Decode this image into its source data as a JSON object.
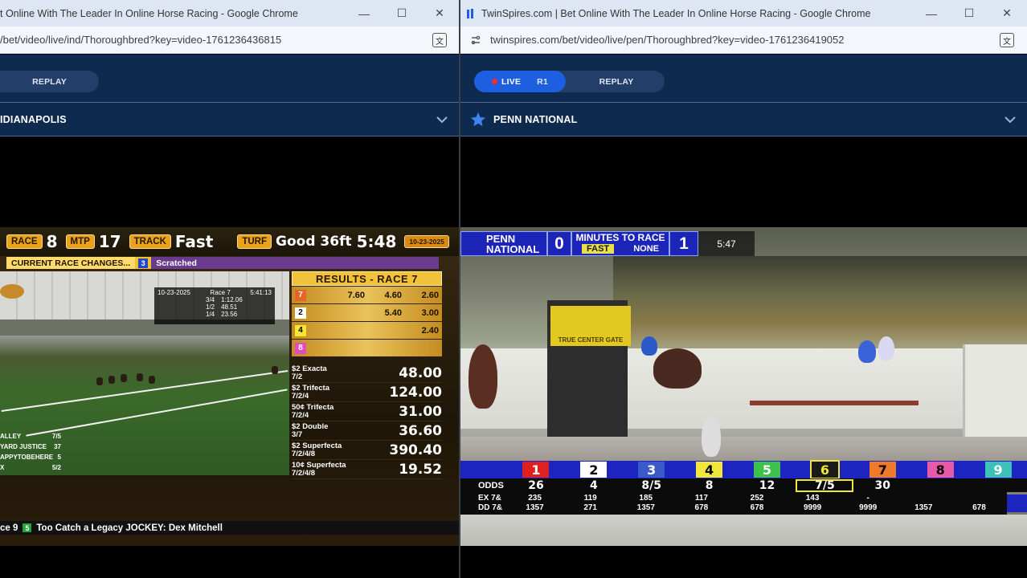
{
  "left": {
    "title": "t Online With The Leader In Online Horse Racing - Google Chrome",
    "url": "/bet/video/live/ind/Thoroughbred?key=video-1761236436815",
    "replay_label": "REPLAY",
    "track": "IDIANAPOLIS",
    "hud": {
      "race_label": "RACE",
      "race": "8",
      "mtp_label": "MTP",
      "mtp": "17",
      "track_label": "TRACK",
      "track_cond": "Fast",
      "turf_label": "TURF",
      "turf_cond": "Good 36ft",
      "clock": "5:48",
      "date": "10-23-2025"
    },
    "changes": {
      "label": "CURRENT RACE CHANGES...",
      "num": "3",
      "text": "Scratched"
    },
    "mini": {
      "date": "10-23-2025",
      "race": "Race 7",
      "time": "5:41:13",
      "f1": "3/4",
      "v1": "1:12.06",
      "f2": "1/2",
      "v2": "48.51",
      "f3": "1/4",
      "v3": "23.56"
    },
    "results": {
      "title": "RESULTS - RACE 7",
      "rows": [
        {
          "pp": "7",
          "pp_bg": "#e8632a",
          "pp_fg": "#ffffff",
          "win": "7.60",
          "place": "4.60",
          "show": "2.60"
        },
        {
          "pp": "2",
          "pp_bg": "#ffffff",
          "pp_fg": "#000000",
          "win": "",
          "place": "5.40",
          "show": "3.00"
        },
        {
          "pp": "4",
          "pp_bg": "#f5e633",
          "pp_fg": "#000000",
          "win": "",
          "place": "",
          "show": "2.40"
        },
        {
          "pp": "8",
          "pp_bg": "#e04ac5",
          "pp_fg": "#ffffff",
          "win": "",
          "place": "",
          "show": ""
        }
      ]
    },
    "exotics": [
      {
        "name": "$2 Exacta",
        "combo": "7/2",
        "payout": "48.00"
      },
      {
        "name": "$2 Trifecta",
        "combo": "7/2/4",
        "payout": "124.00"
      },
      {
        "name": "50¢ Trifecta",
        "combo": "7/2/4",
        "payout": "31.00"
      },
      {
        "name": "$2 Double",
        "combo": "3/7",
        "payout": "36.60"
      },
      {
        "name": "$2 Superfecta",
        "combo": "7/2/4/8",
        "payout": "390.40"
      },
      {
        "name": "10¢ Superfecta",
        "combo": "7/2/4/8",
        "payout": "19.52"
      }
    ],
    "pool": [
      {
        "name": "ALLEY",
        "odds": "7/5"
      },
      {
        "name": "YARD JUSTICE",
        "odds": "37"
      },
      {
        "name": "APPYTOBEHERE",
        "odds": "5"
      },
      {
        "name": "X",
        "odds": "5/2"
      }
    ],
    "ticker": {
      "prefix": "ce 9",
      "num": "5",
      "text": "Too Catch a Legacy  JOCKEY: Dex Mitchell"
    }
  },
  "right": {
    "title": "TwinSpires.com | Bet Online With The Leader In Online Horse Racing - Google Chrome",
    "url": "twinspires.com/bet/video/live/pen/Thoroughbred?key=video-1761236419052",
    "live_label": "LIVE",
    "race_label": "R1",
    "replay_label": "REPLAY",
    "track": "PENN NATIONAL",
    "hud": {
      "name": "PENN NATIONAL",
      "mtp": "0",
      "mtr_label": "MINUTES TO RACE",
      "cond": "FAST",
      "cond2": "NONE",
      "race": "1",
      "time": "5:47"
    },
    "gate_text": "TRUE CENTER GATE",
    "pps": [
      {
        "n": "1",
        "bg": "#e02020",
        "fg": "#ffffff",
        "odds": "26",
        "ex": "235",
        "dd": "1357"
      },
      {
        "n": "2",
        "bg": "#ffffff",
        "fg": "#000000",
        "odds": "4",
        "ex": "119",
        "dd": "271"
      },
      {
        "n": "3",
        "bg": "#3b59c8",
        "fg": "#ffffff",
        "odds": "8/5",
        "ex": "185",
        "dd": "1357"
      },
      {
        "n": "4",
        "bg": "#f3e63a",
        "fg": "#000000",
        "odds": "8",
        "ex": "117",
        "dd": "678"
      },
      {
        "n": "5",
        "bg": "#3ec14a",
        "fg": "#ffffff",
        "odds": "12",
        "ex": "252",
        "dd": "678"
      },
      {
        "n": "6",
        "bg": "#1a1a1a",
        "fg": "#f3e63a",
        "odds": "7/5",
        "ex": "143",
        "dd": "9999"
      },
      {
        "n": "7",
        "bg": "#f07a2a",
        "fg": "#000000",
        "odds": "30",
        "ex": "-",
        "dd": "9999"
      },
      {
        "n": "8",
        "bg": "#e85aa8",
        "fg": "#000000",
        "odds": "",
        "ex": "",
        "dd": "1357"
      },
      {
        "n": "9",
        "bg": "#3cc0b8",
        "fg": "#ffffff",
        "odds": "",
        "ex": "",
        "dd": "678"
      }
    ],
    "odds_label": "ODDS",
    "ex_label": "EX 7&",
    "dd_label": "DD 7&"
  }
}
